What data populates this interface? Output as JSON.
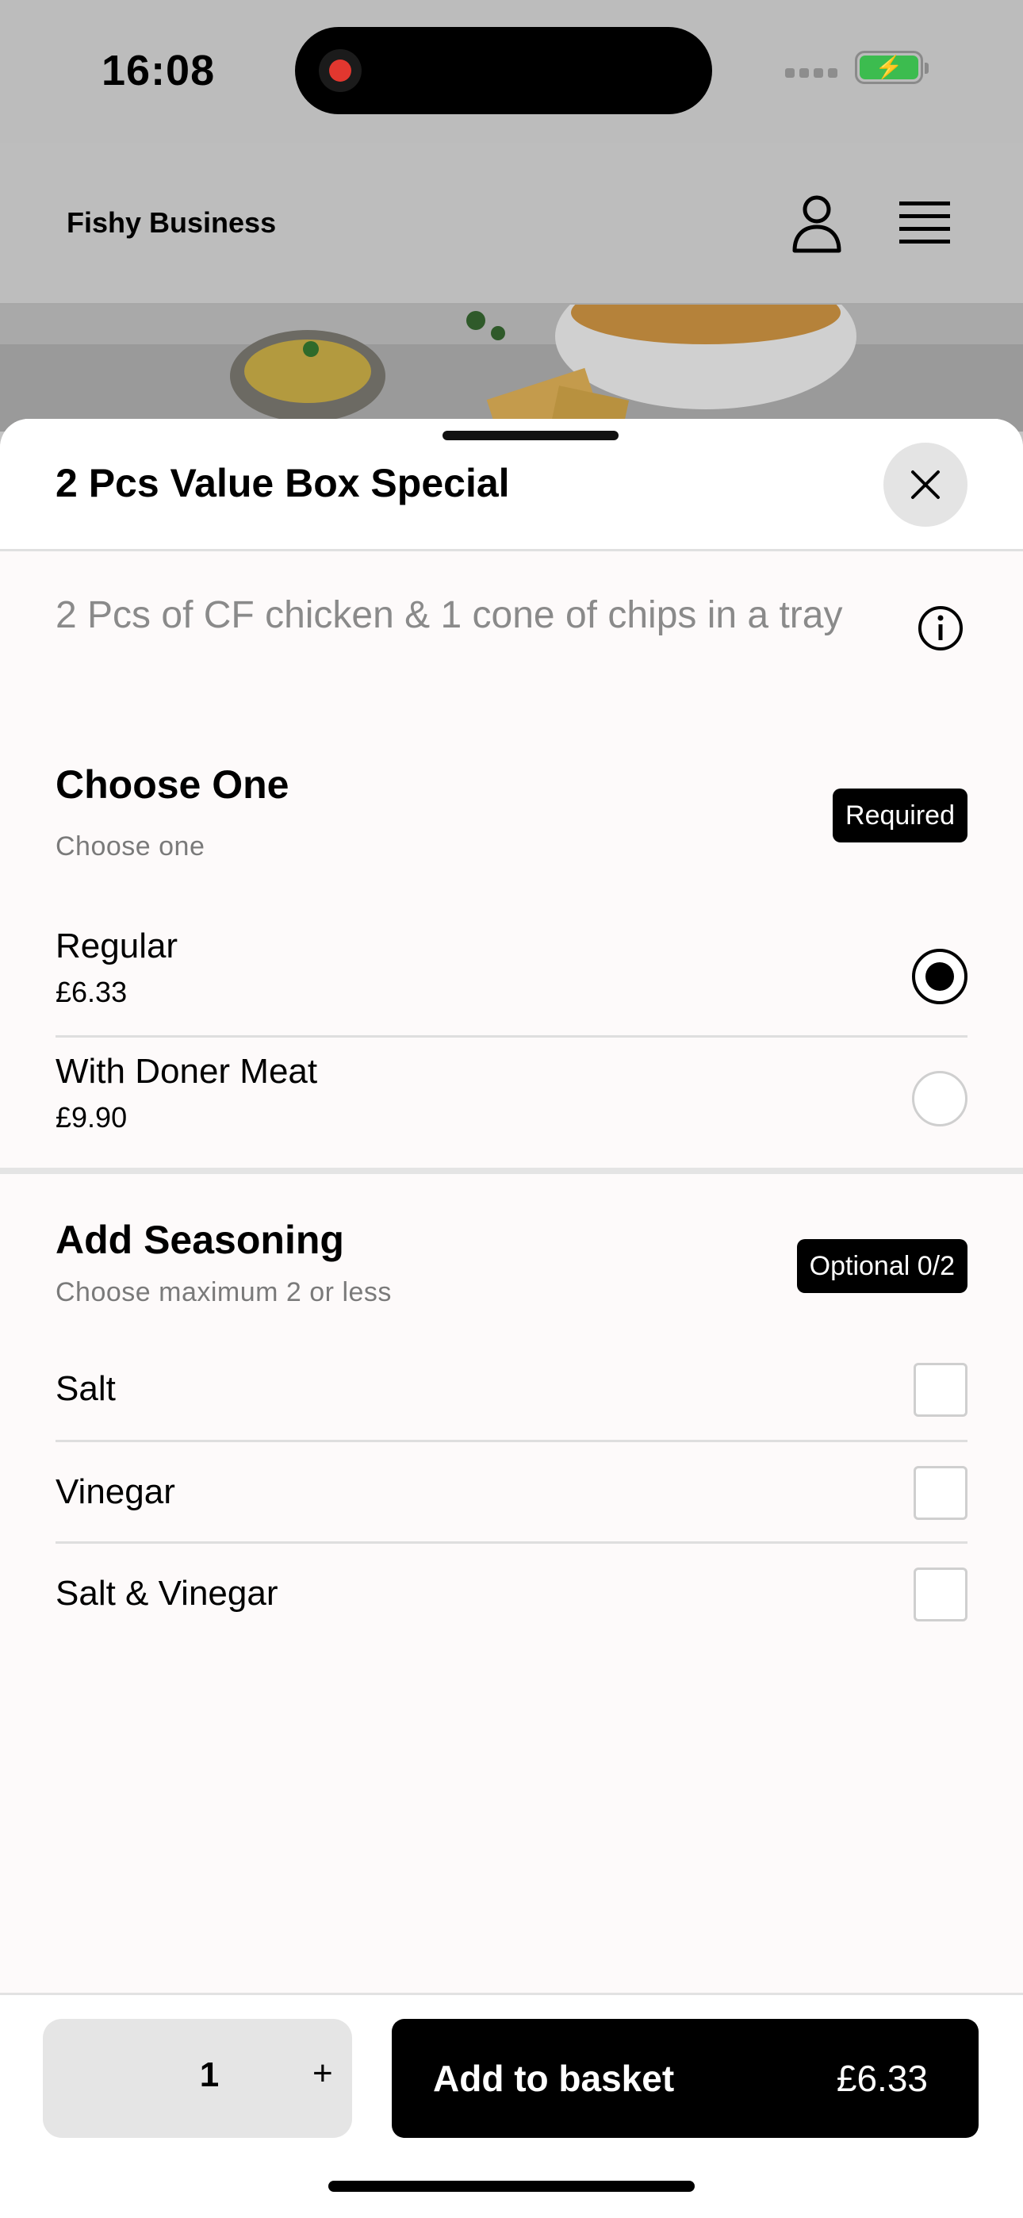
{
  "status_bar": {
    "time": "16:08"
  },
  "header": {
    "brand": "Fishy Business"
  },
  "sheet": {
    "title": "2 Pcs Value Box Special",
    "description": "2 Pcs of CF chicken & 1 cone of chips in a tray"
  },
  "choose_one": {
    "title": "Choose One",
    "subtitle": "Choose one",
    "badge": "Required",
    "options": [
      {
        "name": "Regular",
        "price": "£6.33",
        "selected": true
      },
      {
        "name": "With Doner Meat",
        "price": "£9.90",
        "selected": false
      }
    ]
  },
  "seasoning": {
    "title": "Add Seasoning",
    "subtitle": "Choose maximum 2 or less",
    "badge": "Optional 0/2",
    "options": [
      {
        "name": "Salt",
        "checked": false
      },
      {
        "name": "Vinegar",
        "checked": false
      },
      {
        "name": "Salt & Vinegar",
        "checked": false
      }
    ]
  },
  "footer": {
    "quantity": "1",
    "plus": "+",
    "add_label": "Add to basket",
    "add_price": "£6.33"
  },
  "icons": {
    "record": "record-icon",
    "signal": "signal-icon",
    "battery": "battery-charging-icon",
    "user": "user-icon",
    "menu": "hamburger-menu-icon",
    "close": "close-icon",
    "info": "info-icon"
  },
  "colors": {
    "accent": "#000000",
    "battery": "#3cbc4f",
    "recording": "#e2372f"
  }
}
